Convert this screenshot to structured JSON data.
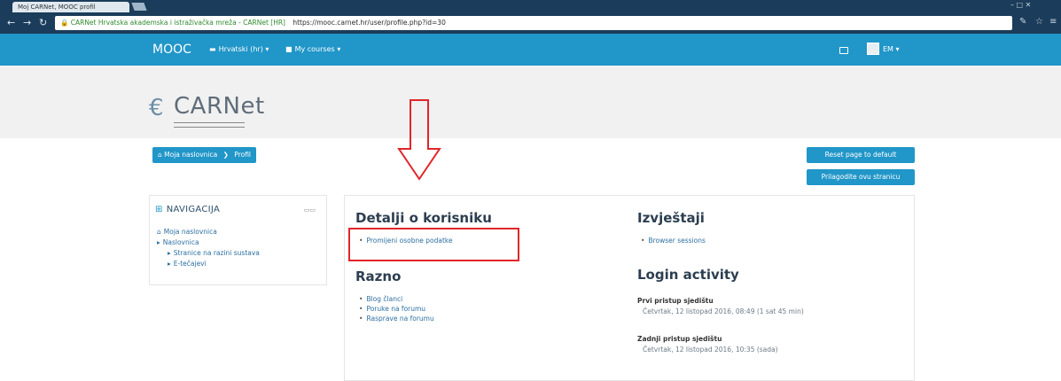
{
  "browser": {
    "tab_title": "Moj CARNet, MOOC profil",
    "window_controls": "–  □  ✕",
    "secure_label": "CARNet Hrvatska akademska i istraživačka mreža - CARNet [HR]",
    "url": "https://mooc.carnet.hr/user/profile.php?id=30"
  },
  "navbar": {
    "brand": "MOOC",
    "language": "Hrvatski (hr) ▾",
    "my_courses": "My courses ▾",
    "user_menu": "EM ▾"
  },
  "header": {
    "logo_text": "CARNet"
  },
  "breadcrumb": {
    "home": "Moja naslovnica",
    "current": "Profil"
  },
  "buttons": {
    "reset": "Reset page to default",
    "customize": "Prilagodite ovu stranicu"
  },
  "navigation": {
    "title": "NAVIGACIJA",
    "items": [
      {
        "label": "Moja naslovnica"
      },
      {
        "label": "Naslovnica"
      },
      {
        "label": "Stranice na razini sustava"
      },
      {
        "label": "E-tečajevi"
      }
    ]
  },
  "details": {
    "title": "Detalji o korisniku",
    "items": [
      {
        "label": "Promijeni osobne podatke"
      }
    ]
  },
  "misc": {
    "title": "Razno",
    "items": [
      {
        "label": "Blog članci"
      },
      {
        "label": "Poruke na forumu"
      },
      {
        "label": "Rasprave na forumu"
      }
    ]
  },
  "reports": {
    "title": "Izvještaji",
    "items": [
      {
        "label": "Browser sessions"
      }
    ]
  },
  "login_activity": {
    "title": "Login activity",
    "first_access_label": "Prvi pristup sjedištu",
    "first_access_value": "Četvrtak, 12 listopad 2016, 08:49  (1 sat 45 min)",
    "last_access_label": "Zadnji pristup sjedištu",
    "last_access_value": "Četvrtak, 12 listopad 2016, 10:35  (sada)"
  },
  "colors": {
    "brand": "#2196c8",
    "highlight": "#e0262b"
  }
}
